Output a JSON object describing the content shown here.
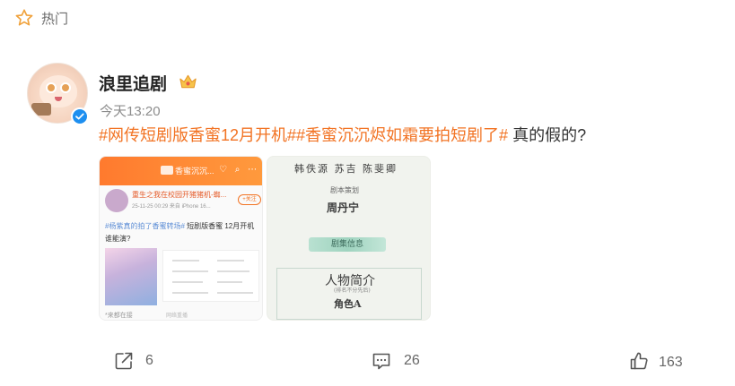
{
  "header": {
    "label": "热门",
    "icon": "star-outline-icon"
  },
  "post": {
    "author": "浪里追剧",
    "author_badge_icon": "crown-icon",
    "verified_icon": "verified-badge-icon",
    "time": "今天13:20",
    "topic1": "#网传短剧版香蜜12月开机#",
    "topic2": "#香蜜沉沉烬如霜要拍短剧了#",
    "text_suffix": " 真的假的?",
    "topic_color": "#f27323"
  },
  "thumbnails": {
    "first": {
      "bar_title": "香蜜沉沉...",
      "poster_name": "重生之我在校园开猪猪机-蜘...",
      "meta": "25-11-25 00:29 来自 iPhone 16...",
      "follow": "+关注",
      "tag": "#杨紫真的拍了香蜜转场#",
      "line1_rest": " 短剧版香蜜 12月开机",
      "line2": "谁能演?",
      "foot": "*来都在接",
      "foot2": "网络重播"
    },
    "second": {
      "names": "韩佚源 苏吉 陈斐卿",
      "role": "剧本策划",
      "person": "周丹宁",
      "info": "剧集信息",
      "title": "人物简介",
      "subtitle": "(排名不分先后)",
      "char": "角色A"
    }
  },
  "actions": {
    "share_count": "6",
    "comment_count": "26",
    "like_count": "163"
  }
}
